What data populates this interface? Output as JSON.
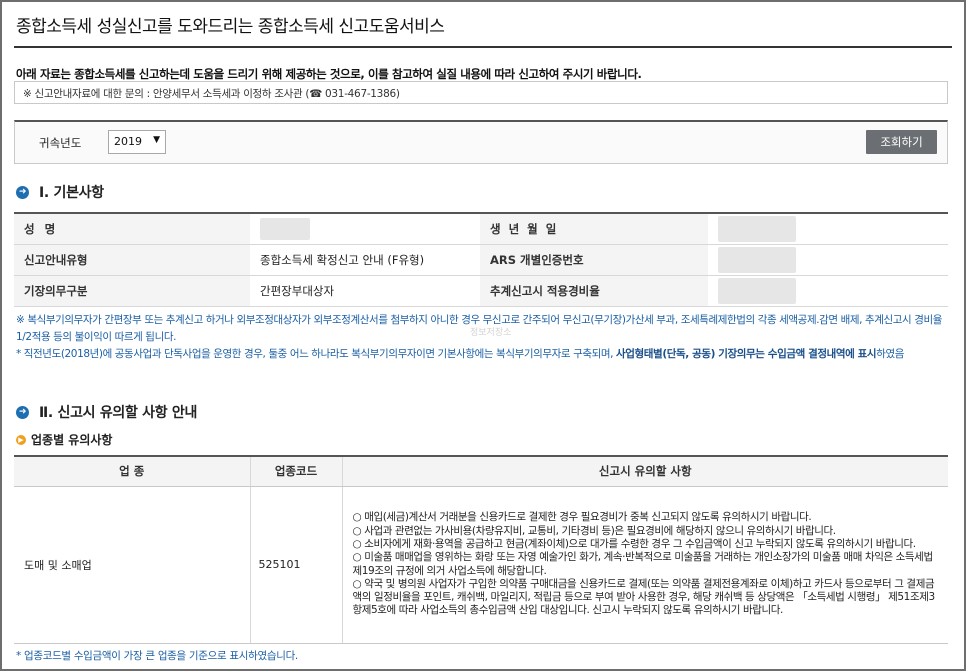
{
  "page": {
    "title": "종합소득세 성실신고를 도와드리는 종합소득세 신고도움서비스",
    "intro": "아래 자료는 종합소득세를 신고하는데 도움을 드리기 위해 제공하는 것으로, 이를 참고하여 실질 내용에 따라 신고하여 주시기 바랍니다.",
    "contact": "※ 신고안내자료에 대한 문의 : 안양세무서 소득세과 이정하 조사관 (☎ 031-467-1386)"
  },
  "search": {
    "label": "귀속년도",
    "year": "2019",
    "button": "조회하기"
  },
  "section1": {
    "title": "Ⅰ. 기본사항",
    "rows": [
      {
        "label_left": "성          명",
        "value_left": "",
        "label_right": "생  년  월  일",
        "value_right": ""
      },
      {
        "label_left": "신고안내유형",
        "value_left": "종합소득세 확정신고 안내 (F유형)",
        "label_right": "ARS 개별인증번호",
        "value_right": ""
      },
      {
        "label_left": "기장의무구분",
        "value_left": "간편장부대상자",
        "label_right": "추계신고시 적용경비율",
        "value_right": ""
      }
    ],
    "note1": "※ 복식부기의무자가 간편장부 또는 추계신고 하거나 외부조정대상자가 외부조정계산서를 첨부하지 아니한 경우 무신고로 간주되어 무신고(무기장)가산세 부과, 조세특례제한법의 각종 세액공제.감면 배제, 추계신고시 경비율 1/2적용 등의 불이익이 따르게 됩니다.",
    "note2_prefix": "* 직전년도(2018년)에 공동사업과 단독사업을 운영한 경우, 둘중 어느 하나라도 복식부기의무자이면 기본사항에는 복식부기의무자로 구축되며,",
    "note2_bold": "사업형태별(단독, 공동) 기장의무는 수입금액 결정내역에 표시",
    "note2_suffix": "하였음"
  },
  "section2": {
    "title": "Ⅱ. 신고시 유의할 사항 안내",
    "subtitle": "업종별 유의사항",
    "headers": [
      "업 종",
      "업종코드",
      "신고시 유의할 사항"
    ],
    "row": {
      "industry": "도매 및 소매업",
      "code": "525101",
      "notes": [
        "○ 매입(세금)계산서 거래분을 신용카드로 결제한 경우 필요경비가 중복 신고되지 않도록 유의하시기 바랍니다.",
        "○ 사업과 관련없는 가사비용(차량유지비, 교통비, 기타경비 등)은 필요경비에 해당하지 않으니 유의하시기 바랍니다.",
        "○ 소비자에게 재화·용역을 공급하고 현금(계좌이체)으로 대가를 수령한 경우 그 수입금액이 신고 누락되지 않도록 유의하시기 바랍니다.",
        "○ 미술품 매매업을 영위하는 화랑 또는 자영 예술가인 화가, 계속·반복적으로 미술품을 거래하는 개인소장가의 미술품 매매 차익은 소득세법 제19조의 규정에 의거 사업소득에 해당합니다.",
        "○ 약국 및 병의원 사업자가 구입한 의약품 구매대금을 신용카드로 결제(또는 의약품 결제전용계좌로 이체)하고 카드사 등으로부터 그 결제금액의 일정비율을 포인트, 캐쉬백, 마일리지, 적립금 등으로 부여 받아 사용한 경우, 해당 캐쉬백 등 상당액은 「소득세법 시행령」 제51조제3항제5호에 따라 사업소득의 총수입금액 산입 대상입니다. 신고시 누락되지 않도록 유의하시기 바랍니다."
      ]
    },
    "footnote": "* 업종코드별 수입금액이 가장 큰 업종을 기준으로 표시하였습니다."
  },
  "watermark": "정보저장소"
}
